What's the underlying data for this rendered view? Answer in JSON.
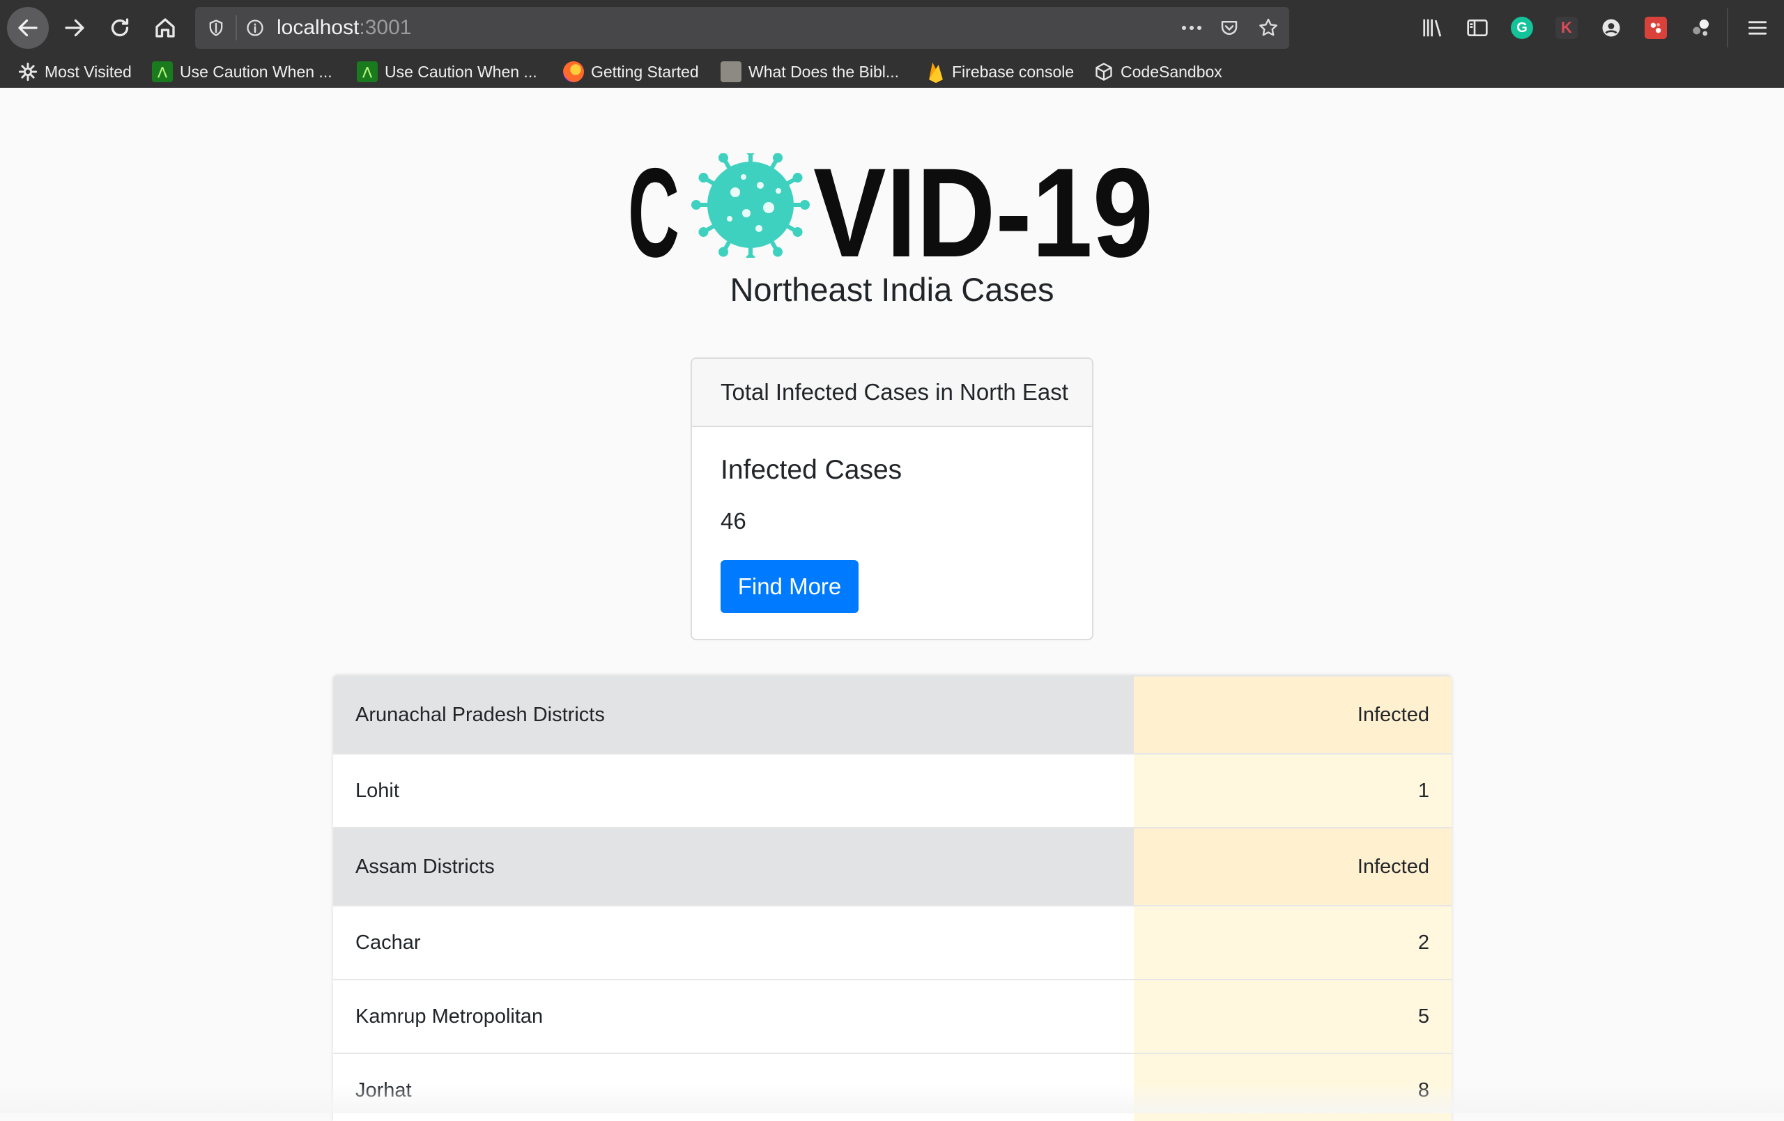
{
  "browser": {
    "url_host": "localhost",
    "url_port": ":3001",
    "bookmarks": [
      {
        "label": "Most Visited",
        "icon": "gear-icon"
      },
      {
        "label": "Use Caution When ...",
        "icon": "android-icon"
      },
      {
        "label": "Use Caution When ...",
        "icon": "android-icon"
      },
      {
        "label": "Getting Started",
        "icon": "firefox-icon"
      },
      {
        "label": "What Does the Bibl...",
        "icon": "puzzle-icon"
      },
      {
        "label": "Firebase console",
        "icon": "firebase-icon"
      },
      {
        "label": "CodeSandbox",
        "icon": "cube-icon"
      }
    ],
    "extension_labels": {
      "grammarly": "G",
      "k": "K"
    }
  },
  "header": {
    "logo_text": "COVID-19",
    "subtitle": "Northeast India Cases"
  },
  "card": {
    "header": "Total Infected Cases in North East",
    "title": "Infected Cases",
    "count": "46",
    "button": "Find More"
  },
  "table": {
    "rows": [
      {
        "type": "head",
        "name": "Arunachal Pradesh Districts",
        "value": "Infected"
      },
      {
        "type": "row",
        "name": "Lohit",
        "value": "1"
      },
      {
        "type": "head",
        "name": "Assam Districts",
        "value": "Infected"
      },
      {
        "type": "row",
        "name": "Cachar",
        "value": "2"
      },
      {
        "type": "row",
        "name": "Kamrup Metropolitan",
        "value": "5"
      },
      {
        "type": "row",
        "name": "Jorhat",
        "value": "8"
      }
    ]
  },
  "colors": {
    "accent": "#007bff",
    "virus": "#3fd1c0",
    "table_head": "#e2e3e5",
    "warning_cell": "#fff8df"
  }
}
